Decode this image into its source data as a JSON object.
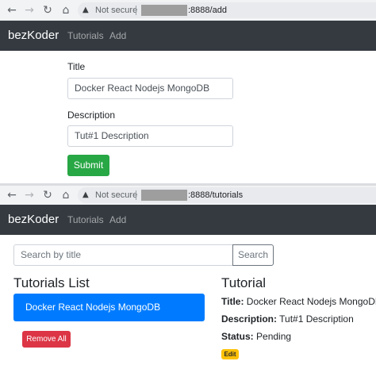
{
  "add_page": {
    "browser": {
      "back_icon": "arrow-left-icon",
      "forward_icon": "arrow-right-icon",
      "reload_icon": "reload-icon",
      "home_icon": "home-icon",
      "security_label": "Not secure",
      "url_suffix": ":8888/add"
    },
    "navbar": {
      "brand": "bezKoder",
      "links": [
        "Tutorials",
        "Add"
      ]
    },
    "form": {
      "title_label": "Title",
      "title_value": "Docker React Nodejs MongoDB",
      "description_label": "Description",
      "description_value": "Tut#1 Description",
      "submit_label": "Submit"
    }
  },
  "list_page": {
    "browser": {
      "security_label": "Not secure",
      "url_suffix": ":8888/tutorials"
    },
    "navbar": {
      "brand": "bezKoder",
      "links": [
        "Tutorials",
        "Add"
      ]
    },
    "search": {
      "placeholder": "Search by title",
      "button_label": "Search"
    },
    "list": {
      "heading": "Tutorials List",
      "items": [
        "Docker React Nodejs MongoDB"
      ],
      "remove_all_label": "Remove All"
    },
    "detail": {
      "heading": "Tutorial",
      "title_key": "Title:",
      "title_value": "Docker React Nodejs MongoDB",
      "description_key": "Description:",
      "description_value": "Tut#1 Description",
      "status_key": "Status:",
      "status_value": "Pending",
      "edit_label": "Edit"
    }
  },
  "colors": {
    "navbar_bg": "#343a40",
    "submit_green": "#28a745",
    "active_blue": "#007bff",
    "danger_red": "#dc3545",
    "warning_yellow": "#ffc107"
  }
}
